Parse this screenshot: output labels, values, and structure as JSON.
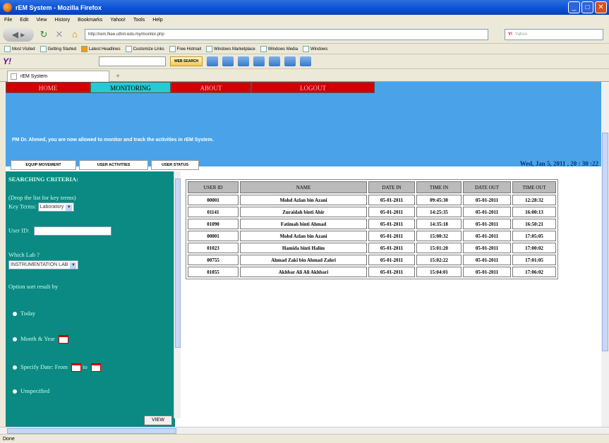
{
  "window": {
    "title": "rEM System - Mozilla Firefox"
  },
  "menu": [
    "File",
    "Edit",
    "View",
    "History",
    "Bookmarks",
    "Yahoo!",
    "Tools",
    "Help"
  ],
  "address": {
    "url": "http://rem.fkee.uthm.edu.my/monitor.php",
    "search_engine": "Y!",
    "search_placeholder": "Yahoo"
  },
  "bookmarks": [
    "Most Visited",
    "Getting Started",
    "Latest Headlines",
    "Customize Links",
    "Free Hotmail",
    "Windows Marketplace",
    "Windows Media",
    "Windows"
  ],
  "yahoo": {
    "websearch_label": "WEB SEARCH"
  },
  "tab": {
    "label": "rEM System"
  },
  "page": {
    "nav": [
      "HOME",
      "MONITORING",
      "ABOUT",
      "LOGOUT"
    ],
    "notice": "PM Dr. Ahmed, you are now allowed to monitor and track the activities in rEM System.",
    "subtabs": [
      "EQUIP MOVEMENT",
      "USER ACTIVITIES",
      "USER STATUS"
    ],
    "datetime": "Wed, Jan 5, 2011 , 20 : 30 :22"
  },
  "search": {
    "title": "SEARCHING CRITERIA:",
    "hint": "(Drop the list for key terms)",
    "key_terms_label": "Key Terms:",
    "key_terms_value": "Laboratory",
    "user_id_label": "User ID:",
    "which_lab_label": "Which Lab ?",
    "lab_value": "INSTRUMENTATION LAB",
    "sort_label": "Option sort result by",
    "options": [
      "Today",
      "Month & Year",
      "Specify Date: From",
      "Unspecified"
    ],
    "to_label": "to",
    "view_button": "VIEW"
  },
  "table": {
    "headers": [
      "USER ID",
      "NAME",
      "DATE IN",
      "TIME IN",
      "DATE OUT",
      "TIME OUT"
    ],
    "rows": [
      [
        "00001",
        "Mohd Azlan bin Azani",
        "05-01-2011",
        "09:45:30",
        "05-01-2011",
        "12:28:32"
      ],
      [
        "01141",
        "Zuraidah binti Ahir",
        "05-01-2011",
        "14:25:35",
        "05-01-2011",
        "16:00:13"
      ],
      [
        "01090",
        "Fatimah binti Ahmad",
        "05-01-2011",
        "14:35:18",
        "05-01-2011",
        "16:50:21"
      ],
      [
        "00001",
        "Mohd Azlan bin Azani",
        "05-01-2011",
        "15:00:32",
        "05-01-2011",
        "17:05:05"
      ],
      [
        "01023",
        "Hamida binti Halim",
        "05-01-2011",
        "15:01:20",
        "05-01-2011",
        "17:00:02"
      ],
      [
        "00755",
        "Ahmad Zaki bin Ahmad Zahri",
        "05-01-2011",
        "15:02:22",
        "05-01-2011",
        "17:01:05"
      ],
      [
        "01055",
        "Akhbar Ali Ali Akhbari",
        "05-01-2011",
        "15:04:01",
        "05-01-2011",
        "17:06:02"
      ]
    ]
  },
  "status": "Done"
}
